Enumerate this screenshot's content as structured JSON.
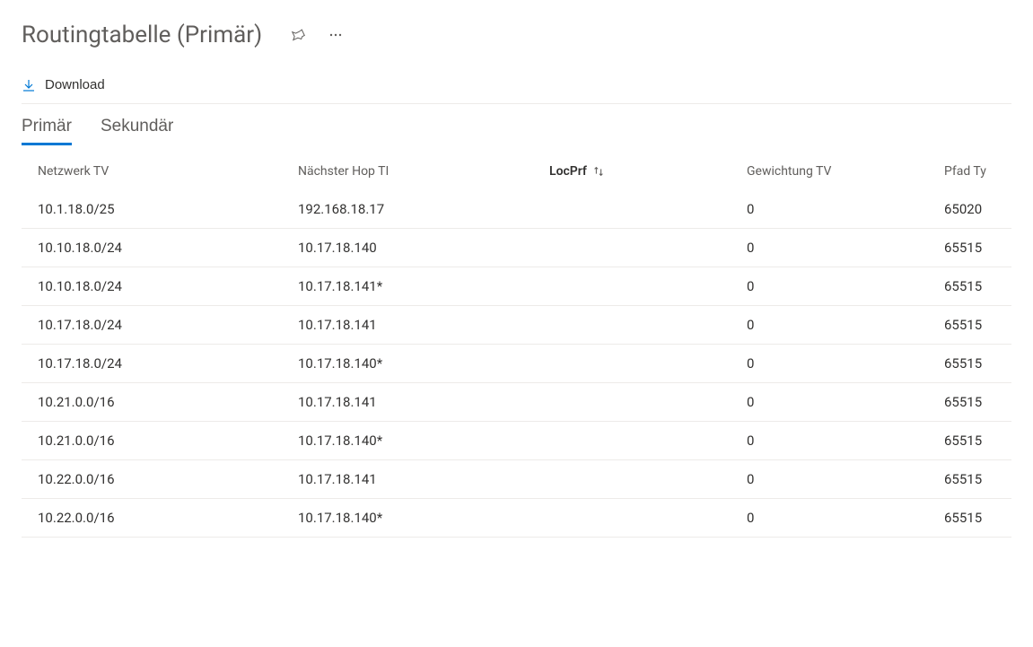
{
  "header": {
    "title": "Routingtabelle (Primär)"
  },
  "toolbar": {
    "download_label": "Download"
  },
  "tabs": [
    {
      "label": "Primär",
      "active": true
    },
    {
      "label": "Sekundär",
      "active": false
    }
  ],
  "table": {
    "columns": {
      "network": "Netzwerk TV",
      "nexthop": "Nächster Hop TI",
      "locprf": "LocPrf",
      "weight": "Gewichtung TV",
      "path": "Pfad Ty"
    },
    "rows": [
      {
        "network": "10.1.18.0/25",
        "nexthop": "192.168.18.17",
        "locprf": "",
        "weight": "0",
        "path": "65020"
      },
      {
        "network": "10.10.18.0/24",
        "nexthop": "10.17.18.140",
        "locprf": "",
        "weight": "0",
        "path": "65515"
      },
      {
        "network": "10.10.18.0/24",
        "nexthop": "10.17.18.141*",
        "locprf": "",
        "weight": "0",
        "path": "65515"
      },
      {
        "network": "10.17.18.0/24",
        "nexthop": "10.17.18.141",
        "locprf": "",
        "weight": "0",
        "path": "65515"
      },
      {
        "network": "10.17.18.0/24",
        "nexthop": "10.17.18.140*",
        "locprf": "",
        "weight": "0",
        "path": "65515"
      },
      {
        "network": "10.21.0.0/16",
        "nexthop": "10.17.18.141",
        "locprf": "",
        "weight": "0",
        "path": "65515"
      },
      {
        "network": "10.21.0.0/16",
        "nexthop": "10.17.18.140*",
        "locprf": "",
        "weight": "0",
        "path": "65515"
      },
      {
        "network": "10.22.0.0/16",
        "nexthop": "10.17.18.141",
        "locprf": "",
        "weight": "0",
        "path": "65515"
      },
      {
        "network": "10.22.0.0/16",
        "nexthop": "10.17.18.140*",
        "locprf": "",
        "weight": "0",
        "path": "65515"
      }
    ]
  }
}
